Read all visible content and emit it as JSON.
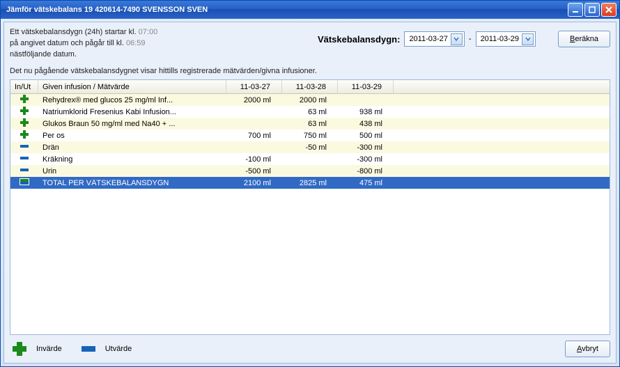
{
  "window": {
    "title": "Jämför vätskebalans 19 420614-7490 SVENSSON SVEN"
  },
  "info": {
    "line1a": "Ett vätskebalansdygn (24h) startar kl. ",
    "time1": "07:00",
    "line2a": "på angivet datum och pågår till kl. ",
    "time2": "06:59",
    "line3": "nästföljande datum.",
    "note": "Det nu pågående vätskebalansdygnet visar hittills registrerade mätvärden/givna infusioner."
  },
  "controls": {
    "label": "Vätskebalansdygn:",
    "date_from": "2011-03-27",
    "dash": "-",
    "date_to": "2011-03-29",
    "calc_btn": "Beräkna",
    "calc_u": "B"
  },
  "headers": {
    "inout": "In/Ut",
    "name": "Given infusion / Mätvärde",
    "d1": "11-03-27",
    "d2": "11-03-28",
    "d3": "11-03-29"
  },
  "rows": [
    {
      "kind": "plus",
      "name": "Rehydrex® med glucos 25 mg/ml  Inf...",
      "d1": "2000 ml",
      "d2": "2000 ml",
      "d3": ""
    },
    {
      "kind": "plus",
      "name": "Natriumklorid Fresenius Kabi  Infusion...",
      "d1": "",
      "d2": "63 ml",
      "d3": "938 ml"
    },
    {
      "kind": "plus",
      "name": "Glukos Braun 50 mg/ml med Na40 + ...",
      "d1": "",
      "d2": "63 ml",
      "d3": "438 ml"
    },
    {
      "kind": "plus",
      "name": "Per os",
      "d1": "700 ml",
      "d2": "750 ml",
      "d3": "500 ml"
    },
    {
      "kind": "minus",
      "name": "Drän",
      "d1": "",
      "d2": "-50 ml",
      "d3": "-300 ml"
    },
    {
      "kind": "minus",
      "name": "Kräkning",
      "d1": "-100 ml",
      "d2": "",
      "d3": "-300 ml"
    },
    {
      "kind": "minus",
      "name": "Urin",
      "d1": "-500 ml",
      "d2": "",
      "d3": "-800 ml"
    },
    {
      "kind": "total",
      "name": "TOTAL PER VÄTSKEBALANSDYGN",
      "d1": "2100 ml",
      "d2": "2825 ml",
      "d3": "475 ml"
    }
  ],
  "legend": {
    "in": "Invärde",
    "out": "Utvärde"
  },
  "footer": {
    "cancel": "Avbryt",
    "cancel_u": "A"
  }
}
